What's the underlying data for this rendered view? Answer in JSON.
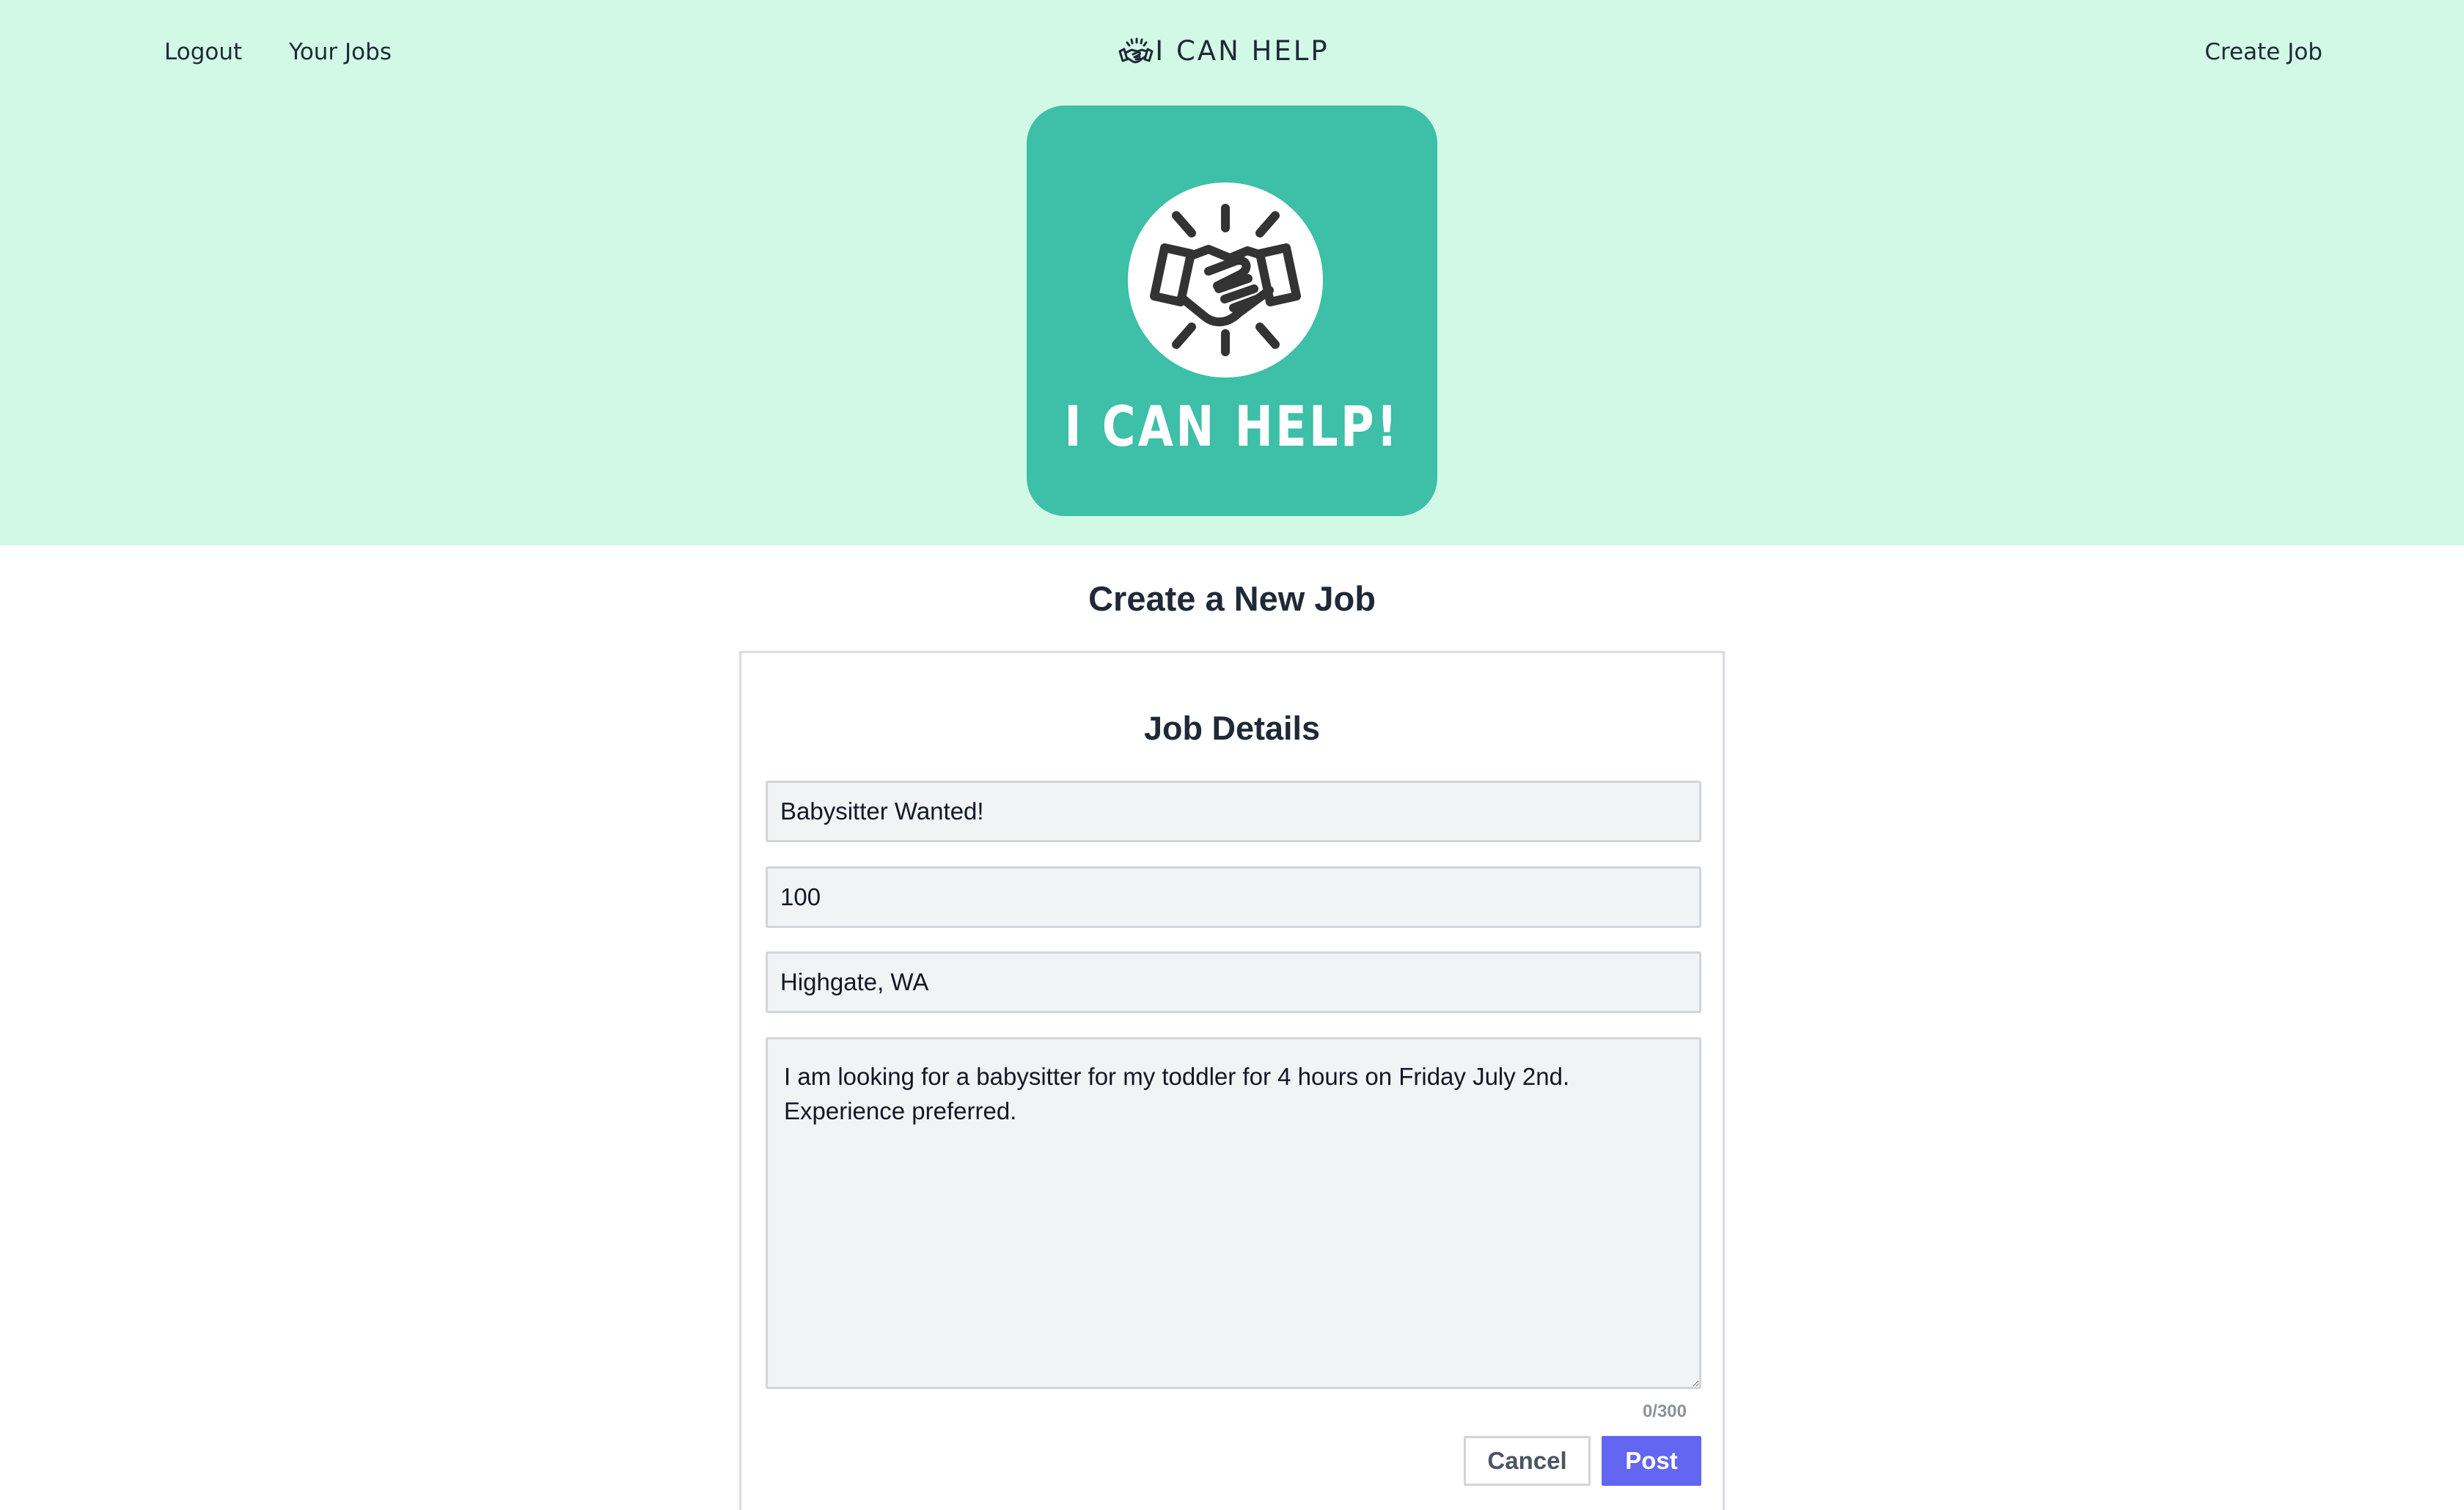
{
  "nav": {
    "logout": "Logout",
    "your_jobs": "Your Jobs",
    "create_job": "Create Job"
  },
  "brand": {
    "name": "I CAN HELP",
    "icon": "handshake-icon"
  },
  "logo": {
    "text": "I CAN HELP!",
    "icon": "handshake-icon",
    "background_color": "#3ebfa7"
  },
  "page": {
    "title": "Create a New Job"
  },
  "form": {
    "heading": "Job Details",
    "title_value": "Babysitter Wanted!",
    "price_value": "100",
    "location_value": "Highgate, WA",
    "description_value": "I am looking for a babysitter for my toddler for 4 hours on Friday July 2nd. Experience preferred.",
    "char_count": "0/300",
    "cancel_label": "Cancel",
    "post_label": "Post"
  },
  "colors": {
    "header_background": "#d1f9e5",
    "accent": "#6366f1",
    "logo_teal": "#3ebfa7"
  }
}
